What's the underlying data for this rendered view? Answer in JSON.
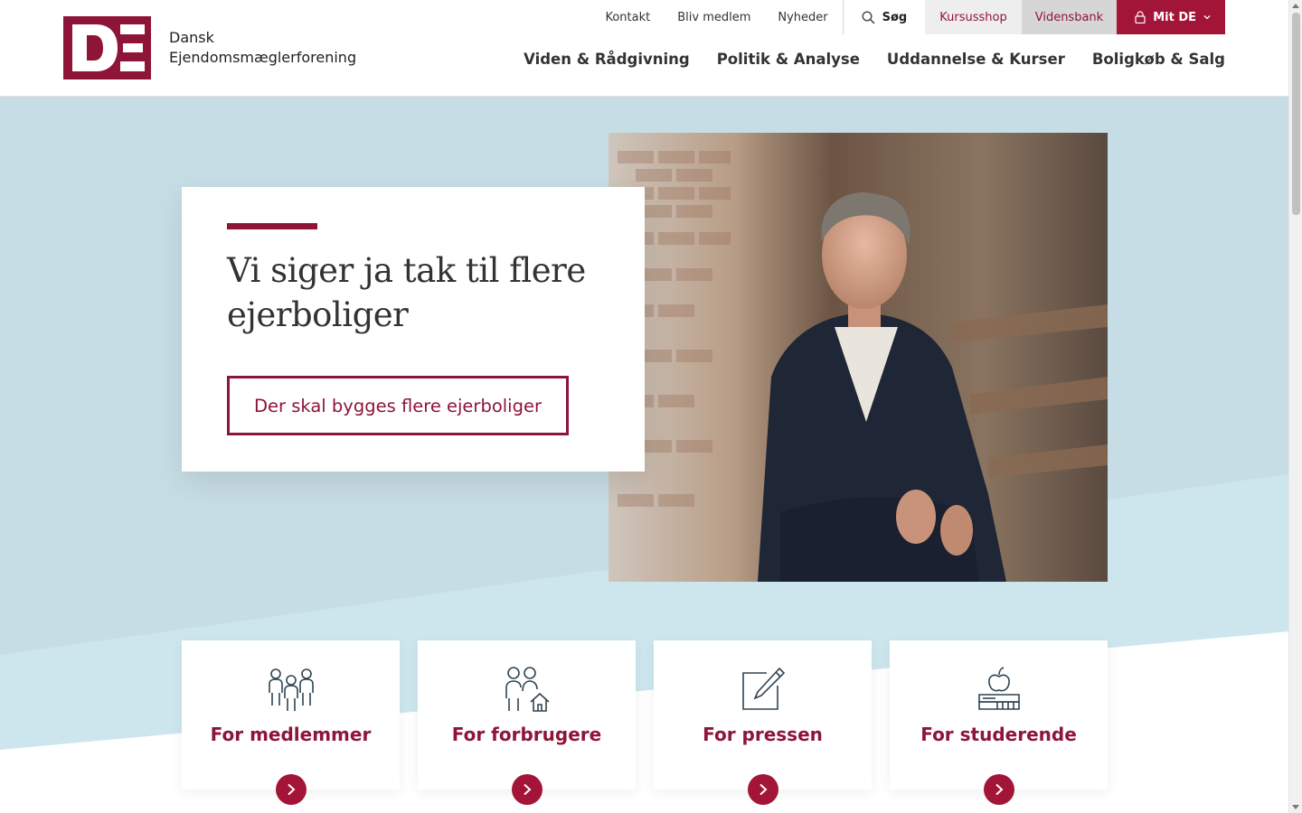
{
  "brand": {
    "name_line1": "Dansk",
    "name_line2": "Ejendomsmæglerforening",
    "logo_letters": "DE",
    "primary_color": "#8e1538",
    "button_color": "#a31538",
    "hero_bg_color": "#c7dde5"
  },
  "topnav": {
    "links": [
      "Kontakt",
      "Bliv medlem",
      "Nyheder"
    ],
    "search_label": "Søg",
    "kursusshop_label": "Kursusshop",
    "vidensbank_label": "Vidensbank",
    "mitde_label": "Mit DE"
  },
  "mainnav": {
    "items": [
      "Viden & Rådgivning",
      "Politik & Analyse",
      "Uddannelse & Kurser",
      "Boligkøb & Salg"
    ]
  },
  "hero": {
    "heading": "Vi siger ja tak til flere ejerboliger",
    "cta_label": "Der skal bygges flere ejerboliger",
    "photo": "portrait-of-man-in-suit-on-stairs"
  },
  "tiles": [
    {
      "label": "For medlemmer",
      "icon": "people-group-icon"
    },
    {
      "label": "For forbrugere",
      "icon": "family-house-icon"
    },
    {
      "label": "For pressen",
      "icon": "pen-paper-icon"
    },
    {
      "label": "For studerende",
      "icon": "apple-books-icon"
    }
  ]
}
